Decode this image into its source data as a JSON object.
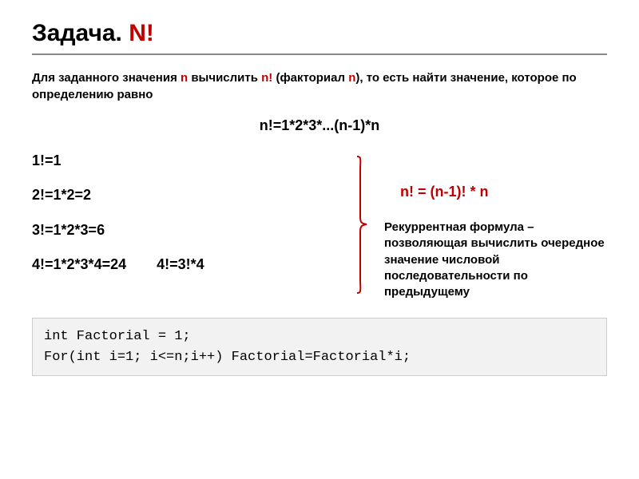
{
  "title": {
    "prefix": "Задача. ",
    "red": "N!"
  },
  "description": {
    "part1": "Для заданного значения ",
    "n1": "n",
    "part2": " вычислить ",
    "n2": "n!",
    "part3": " (факториал ",
    "n3": "n",
    "part4": "), то есть найти значение, которое по определению равно"
  },
  "main_formula": "n!=1*2*3*...(n-1)*n",
  "examples": {
    "e1": "1!=1",
    "e2": "2!=1*2=2",
    "e3": "3!=1*2*3=6",
    "e4a": "4!=1*2*3*4=24",
    "e4b": "4!=3!*4"
  },
  "recurrent": {
    "formula": "n! = (n-1)! * n",
    "desc": "Рекуррентная формула – позволяющая вычислить очередное значение числовой последовательности по предыдущему"
  },
  "code": {
    "line1": "int Factorial = 1;",
    "line2": "For(int i=1; i<=n;i++) Factorial=Factorial*i;"
  }
}
